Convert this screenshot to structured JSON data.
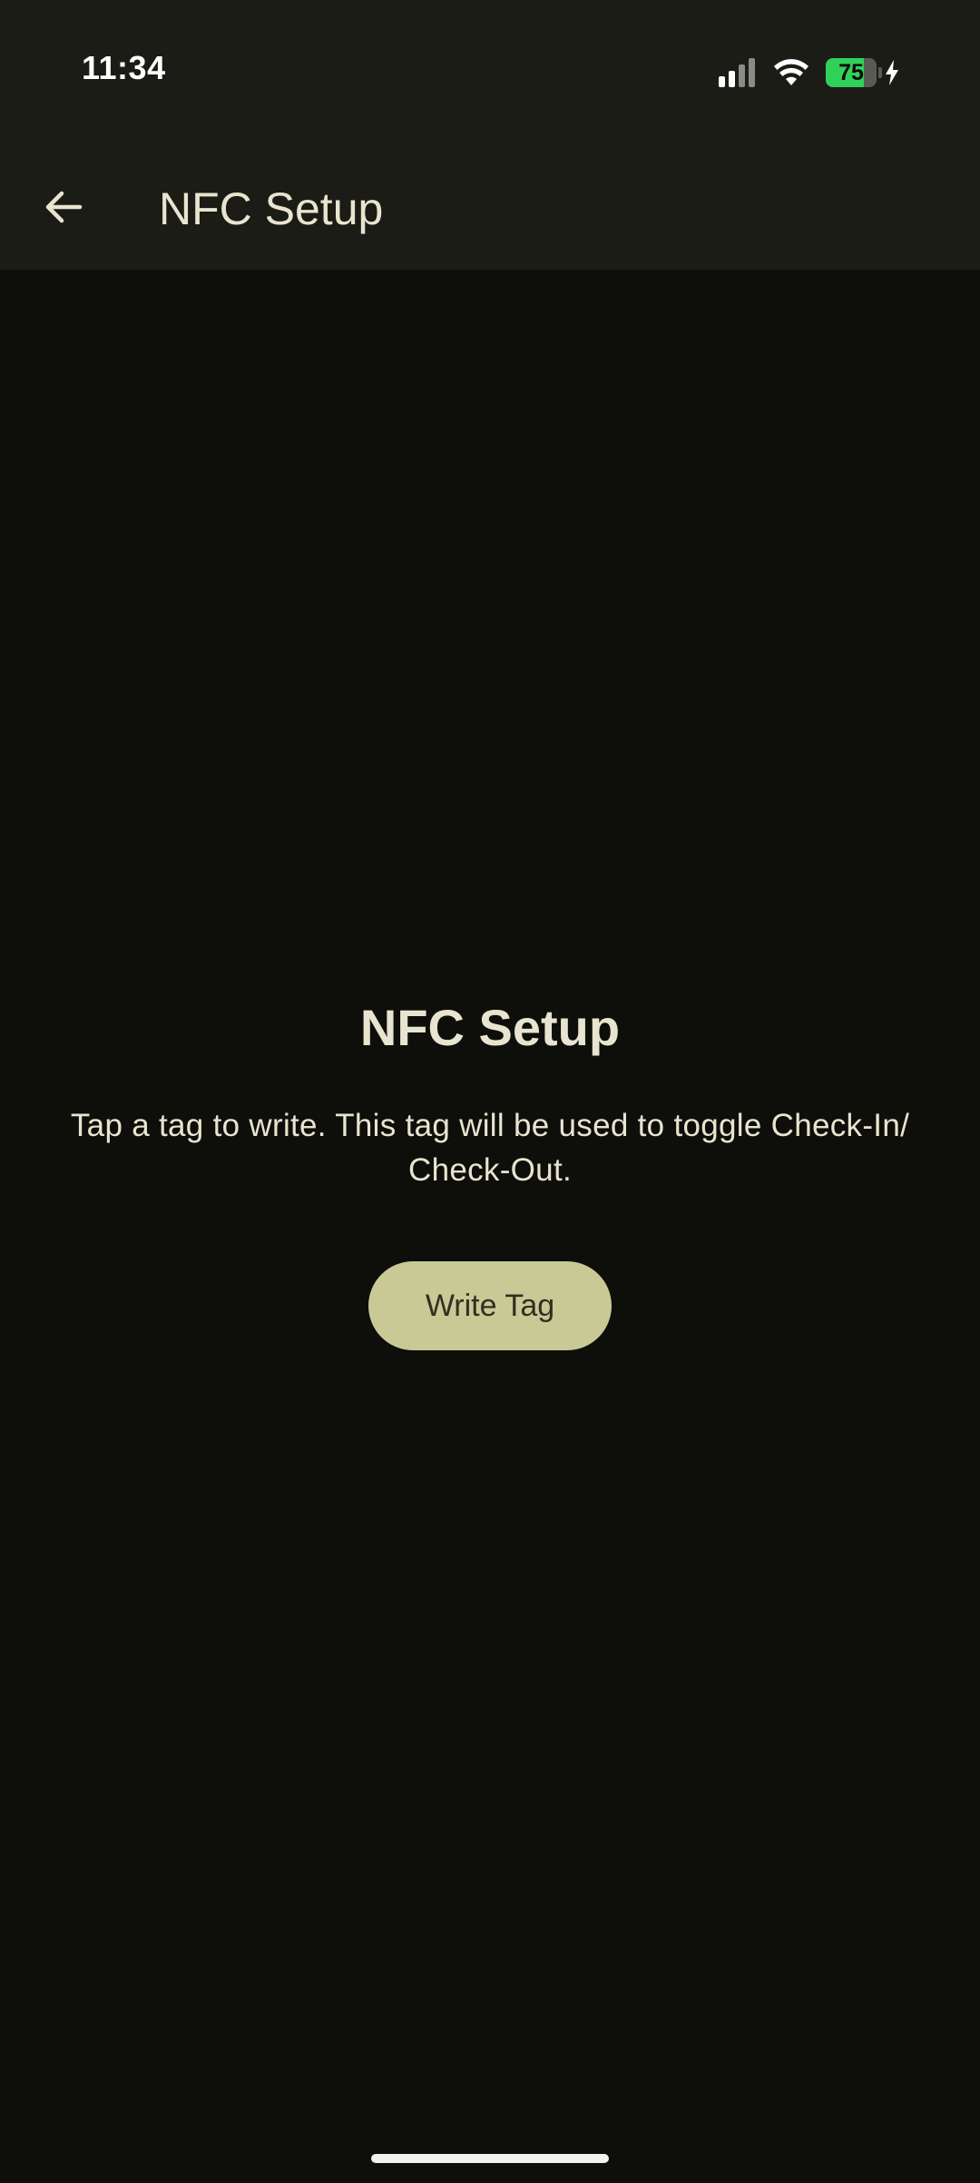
{
  "status_bar": {
    "time": "11:34",
    "battery_level": "75",
    "battery_fraction": 0.75,
    "signal_icon": "cellular-signal-icon",
    "wifi_icon": "wifi-icon",
    "charging_icon": "charging-bolt-icon"
  },
  "app_bar": {
    "back_icon": "arrow-back-icon",
    "title": "NFC Setup"
  },
  "main": {
    "heading": "NFC Setup",
    "description": "Tap a tag to write. This tag will be used to toggle Check-In/ Check-Out.",
    "write_button_label": "Write Tag"
  },
  "colors": {
    "background": "#0e0f0b",
    "surface": "#1c1c16",
    "on_surface": "#e8e4cf",
    "primary_container": "#c9c995",
    "battery_green": "#30d158"
  }
}
